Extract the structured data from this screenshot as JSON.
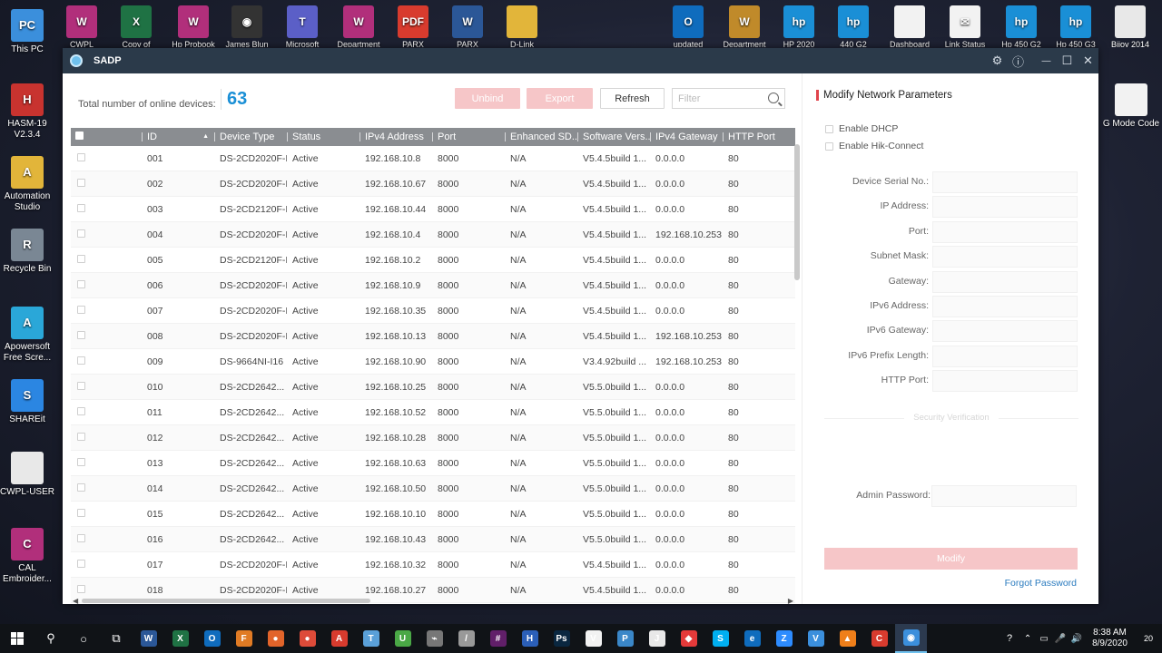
{
  "desktop": {
    "left_icons": [
      {
        "label": "This PC",
        "name": "this-pc",
        "color": "#3b8fdc",
        "glyph": "PC"
      },
      {
        "label": "HASM-19 V2.3.4",
        "name": "hasm-19",
        "color": "#c8332f",
        "glyph": "H"
      },
      {
        "label": "Automation Studio",
        "name": "automation-studio",
        "color": "#e2b53a",
        "glyph": "A"
      },
      {
        "label": "Recycle Bin",
        "name": "recycle-bin",
        "color": "#7a8794",
        "glyph": "R"
      },
      {
        "label": "Apowersoft Free Scre...",
        "name": "apowersoft",
        "color": "#2aa7d8",
        "glyph": "A"
      },
      {
        "label": "SHAREit",
        "name": "shareit",
        "color": "#2b86e2",
        "glyph": "S"
      },
      {
        "label": "CWPL-USER",
        "name": "cwpl-user",
        "color": "#e8e8e8",
        "glyph": ""
      },
      {
        "label": "CAL Embroider...",
        "name": "cal-embroider",
        "color": "#b12f7b",
        "glyph": "C"
      }
    ],
    "top_icons": [
      {
        "label": "CWPL",
        "name": "cwpl",
        "color": "#b12f7b",
        "glyph": "W"
      },
      {
        "label": "Copy of",
        "name": "copy-of",
        "color": "#1f7244",
        "glyph": "X"
      },
      {
        "label": "Hp Probook",
        "name": "hp-probook",
        "color": "#b12f7b",
        "glyph": "W"
      },
      {
        "label": "James Blun",
        "name": "james-blun",
        "color": "#333",
        "glyph": "◉"
      },
      {
        "label": "Microsoft",
        "name": "microsoft-teams",
        "color": "#5b5fc7",
        "glyph": "T"
      },
      {
        "label": "Department",
        "name": "department-1",
        "color": "#b12f7b",
        "glyph": "W"
      },
      {
        "label": "PARX",
        "name": "parx-pdf",
        "color": "#d83b2e",
        "glyph": "PDF"
      },
      {
        "label": "PARX",
        "name": "parx-word",
        "color": "#2b5797",
        "glyph": "W"
      },
      {
        "label": "D-Link",
        "name": "d-link",
        "color": "#e2b53a",
        "glyph": ""
      },
      {
        "label": "updated",
        "name": "updated",
        "color": "#0f6cbd",
        "glyph": "O"
      },
      {
        "label": "Department",
        "name": "department-2",
        "color": "#c08a2a",
        "glyph": "W"
      },
      {
        "label": "HP 2020",
        "name": "hp-2020",
        "color": "#1a8fd6",
        "glyph": "hp"
      },
      {
        "label": "440 G2",
        "name": "440-g2",
        "color": "#1a8fd6",
        "glyph": "hp"
      },
      {
        "label": "Dashboard",
        "name": "dashboard",
        "color": "#f2f2f2",
        "glyph": ""
      },
      {
        "label": "Link Status",
        "name": "link-status",
        "color": "#f2f2f2",
        "glyph": "✉"
      },
      {
        "label": "Hp 450 G2",
        "name": "hp-450-g2-a",
        "color": "#1a8fd6",
        "glyph": "hp"
      },
      {
        "label": "Hp 450 G3",
        "name": "hp-450-g3",
        "color": "#1a8fd6",
        "glyph": "hp"
      },
      {
        "label": "Bijoy 2014",
        "name": "bijoy-2014",
        "color": "#e8e8e8",
        "glyph": ""
      }
    ],
    "right_icons": [
      {
        "label": "G Mode Code",
        "name": "g-mode-code",
        "color": "#f2f2f2",
        "glyph": ""
      }
    ]
  },
  "window": {
    "title": "SADP",
    "settings_glyph": "⚙",
    "info_glyph": "ⓘ",
    "min_glyph": "—",
    "max_glyph": "☐",
    "close_glyph": "✕"
  },
  "toolbar": {
    "count_label": "Total number of online devices:",
    "count_value": "63",
    "unbind_label": "Unbind",
    "export_label": "Export",
    "refresh_label": "Refresh",
    "filter_placeholder": "Filter"
  },
  "table": {
    "columns": [
      "ID",
      "Device Type",
      "Status",
      "IPv4 Address",
      "Port",
      "Enhanced SD...",
      "Software Vers...",
      "IPv4 Gateway",
      "HTTP Port"
    ],
    "sort_glyph": "▲",
    "rows": [
      [
        "001",
        "DS-2CD2020F-I",
        "Active",
        "192.168.10.8",
        "8000",
        "N/A",
        "V5.4.5build 1...",
        "0.0.0.0",
        "80"
      ],
      [
        "002",
        "DS-2CD2020F-I",
        "Active",
        "192.168.10.67",
        "8000",
        "N/A",
        "V5.4.5build 1...",
        "0.0.0.0",
        "80"
      ],
      [
        "003",
        "DS-2CD2120F-I",
        "Active",
        "192.168.10.44",
        "8000",
        "N/A",
        "V5.4.5build 1...",
        "0.0.0.0",
        "80"
      ],
      [
        "004",
        "DS-2CD2020F-I",
        "Active",
        "192.168.10.4",
        "8000",
        "N/A",
        "V5.4.5build 1...",
        "192.168.10.253",
        "80"
      ],
      [
        "005",
        "DS-2CD2120F-I",
        "Active",
        "192.168.10.2",
        "8000",
        "N/A",
        "V5.4.5build 1...",
        "0.0.0.0",
        "80"
      ],
      [
        "006",
        "DS-2CD2020F-I",
        "Active",
        "192.168.10.9",
        "8000",
        "N/A",
        "V5.4.5build 1...",
        "0.0.0.0",
        "80"
      ],
      [
        "007",
        "DS-2CD2020F-I",
        "Active",
        "192.168.10.35",
        "8000",
        "N/A",
        "V5.4.5build 1...",
        "0.0.0.0",
        "80"
      ],
      [
        "008",
        "DS-2CD2020F-I",
        "Active",
        "192.168.10.13",
        "8000",
        "N/A",
        "V5.4.5build 1...",
        "192.168.10.253",
        "80"
      ],
      [
        "009",
        "DS-9664NI-I16",
        "Active",
        "192.168.10.90",
        "8000",
        "N/A",
        "V3.4.92build ...",
        "192.168.10.253",
        "80"
      ],
      [
        "010",
        "DS-2CD2642...",
        "Active",
        "192.168.10.25",
        "8000",
        "N/A",
        "V5.5.0build 1...",
        "0.0.0.0",
        "80"
      ],
      [
        "011",
        "DS-2CD2642...",
        "Active",
        "192.168.10.52",
        "8000",
        "N/A",
        "V5.5.0build 1...",
        "0.0.0.0",
        "80"
      ],
      [
        "012",
        "DS-2CD2642...",
        "Active",
        "192.168.10.28",
        "8000",
        "N/A",
        "V5.5.0build 1...",
        "0.0.0.0",
        "80"
      ],
      [
        "013",
        "DS-2CD2642...",
        "Active",
        "192.168.10.63",
        "8000",
        "N/A",
        "V5.5.0build 1...",
        "0.0.0.0",
        "80"
      ],
      [
        "014",
        "DS-2CD2642...",
        "Active",
        "192.168.10.50",
        "8000",
        "N/A",
        "V5.5.0build 1...",
        "0.0.0.0",
        "80"
      ],
      [
        "015",
        "DS-2CD2642...",
        "Active",
        "192.168.10.10",
        "8000",
        "N/A",
        "V5.5.0build 1...",
        "0.0.0.0",
        "80"
      ],
      [
        "016",
        "DS-2CD2642...",
        "Active",
        "192.168.10.43",
        "8000",
        "N/A",
        "V5.5.0build 1...",
        "0.0.0.0",
        "80"
      ],
      [
        "017",
        "DS-2CD2020F-I",
        "Active",
        "192.168.10.32",
        "8000",
        "N/A",
        "V5.4.5build 1...",
        "0.0.0.0",
        "80"
      ],
      [
        "018",
        "DS-2CD2020F-I",
        "Active",
        "192.168.10.27",
        "8000",
        "N/A",
        "V5.4.5build 1...",
        "0.0.0.0",
        "80"
      ]
    ]
  },
  "panel": {
    "title": "Modify Network Parameters",
    "enable_dhcp": "Enable DHCP",
    "enable_hik_connect": "Enable Hik-Connect",
    "fields": [
      {
        "label": "Device Serial No.:",
        "name": "device-serial-field",
        "value": ""
      },
      {
        "label": "IP Address:",
        "name": "ip-address-field",
        "value": ""
      },
      {
        "label": "Port:",
        "name": "port-field",
        "value": ""
      },
      {
        "label": "Subnet Mask:",
        "name": "subnet-mask-field",
        "value": ""
      },
      {
        "label": "Gateway:",
        "name": "gateway-field",
        "value": ""
      },
      {
        "label": "IPv6 Address:",
        "name": "ipv6-address-field",
        "value": ""
      },
      {
        "label": "IPv6 Gateway:",
        "name": "ipv6-gateway-field",
        "value": ""
      },
      {
        "label": "IPv6 Prefix Length:",
        "name": "ipv6-prefix-field",
        "value": ""
      },
      {
        "label": "HTTP Port:",
        "name": "http-port-field",
        "value": ""
      }
    ],
    "security_verification": "Security Verification",
    "admin_password_label": "Admin Password:",
    "modify_label": "Modify",
    "forgot_password": "Forgot Password"
  },
  "taskbar": {
    "time": "8:38 AM",
    "date": "8/9/2020",
    "notification_count": "20",
    "apps": [
      {
        "name": "word-taskbar",
        "color": "#2b5797",
        "glyph": "W"
      },
      {
        "name": "excel-taskbar",
        "color": "#1f7244",
        "glyph": "X"
      },
      {
        "name": "outlook-taskbar",
        "color": "#0f6cbd",
        "glyph": "O"
      },
      {
        "name": "file-manager-taskbar",
        "color": "#e07b24",
        "glyph": "F"
      },
      {
        "name": "firefox-taskbar",
        "color": "#e2642a",
        "glyph": "●"
      },
      {
        "name": "chrome-taskbar",
        "color": "#dd4b39",
        "glyph": "●"
      },
      {
        "name": "acrobat-taskbar",
        "color": "#d83b2e",
        "glyph": "A"
      },
      {
        "name": "tool-taskbar",
        "color": "#5aa0d8",
        "glyph": "T"
      },
      {
        "name": "utorrent-taskbar",
        "color": "#4aa846",
        "glyph": "U"
      },
      {
        "name": "usb-taskbar",
        "color": "#777",
        "glyph": "⌁"
      },
      {
        "name": "pen-taskbar",
        "color": "#999",
        "glyph": "/"
      },
      {
        "name": "slack-taskbar",
        "color": "#611f69",
        "glyph": "#"
      },
      {
        "name": "h-app-taskbar",
        "color": "#2b5fb8",
        "glyph": "H"
      },
      {
        "name": "photoshop-taskbar",
        "color": "#0a2740",
        "glyph": "Ps"
      },
      {
        "name": "vnc-taskbar",
        "color": "#f2f2f2",
        "glyph": "V"
      },
      {
        "name": "paint-taskbar",
        "color": "#3a87c8",
        "glyph": "P"
      },
      {
        "name": "java-taskbar",
        "color": "#e8e8e8",
        "glyph": "J"
      },
      {
        "name": "anydesk-taskbar",
        "color": "#e53a3a",
        "glyph": "◆"
      },
      {
        "name": "skype-taskbar",
        "color": "#00aff0",
        "glyph": "S"
      },
      {
        "name": "edge-taskbar",
        "color": "#0f6cbd",
        "glyph": "e"
      },
      {
        "name": "zoom-taskbar",
        "color": "#2d8cff",
        "glyph": "Z"
      },
      {
        "name": "vpn-taskbar",
        "color": "#3b8fdc",
        "glyph": "V"
      },
      {
        "name": "vlc-taskbar",
        "color": "#ef7f1a",
        "glyph": "▲"
      },
      {
        "name": "app-red-taskbar",
        "color": "#d83b2e",
        "glyph": "C"
      },
      {
        "name": "sadp-taskbar",
        "color": "#3b8fdc",
        "glyph": "◉"
      }
    ]
  }
}
